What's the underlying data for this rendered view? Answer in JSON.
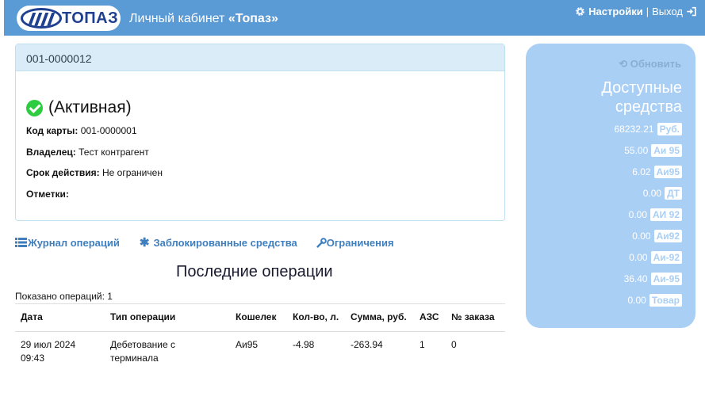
{
  "header": {
    "logo_text": "ТОПАЗ",
    "title_prefix": "Личный кабинет ",
    "title_brand": "«Топаз»",
    "settings_label": "Настройки",
    "separator": "|",
    "logout_label": "Выход",
    "accent_color": "#5b9bd5"
  },
  "card": {
    "panel_title": "001-0000012",
    "status_text": "(Активная)",
    "code_label": "Код карты:",
    "code_value": "001-0000001",
    "owner_label": "Владелец:",
    "owner_value": "Тест контрагент",
    "validity_label": "Срок действия:",
    "validity_value": "Не ограничен",
    "notes_label": "Отметки:",
    "notes_value": ""
  },
  "links": {
    "journal": "Журнал операций",
    "blocked": "Заблокированные средства",
    "limits": "Ограничения"
  },
  "operations": {
    "title": "Последние операции",
    "shown": "Показано операций: 1",
    "columns": [
      "Дата",
      "Тип операции",
      "Кошелек",
      "Кол-во, л.",
      "Сумма, руб.",
      "АЗС",
      "№ заказа"
    ],
    "rows": [
      [
        "29 июл 2024 09:43",
        "Дебетование с терминала",
        "Аи95",
        "-4.98",
        "-263.94",
        "1",
        "0"
      ]
    ]
  },
  "funds": {
    "refresh_label": "Обновить",
    "title_line1": "Доступные",
    "title_line2": "средства",
    "balances": [
      {
        "amount": "68232.21",
        "unit": "Руб."
      },
      {
        "amount": "55.00",
        "unit": "Аи 95"
      },
      {
        "amount": "6.02",
        "unit": "Аи95"
      },
      {
        "amount": "0.00",
        "unit": "ДТ"
      },
      {
        "amount": "0.00",
        "unit": "АИ 92"
      },
      {
        "amount": "0.00",
        "unit": "Аи92"
      },
      {
        "amount": "0.00",
        "unit": "Аи-92"
      },
      {
        "amount": "36.40",
        "unit": "Аи-95"
      },
      {
        "amount": "0.00",
        "unit": "Товар"
      }
    ]
  }
}
